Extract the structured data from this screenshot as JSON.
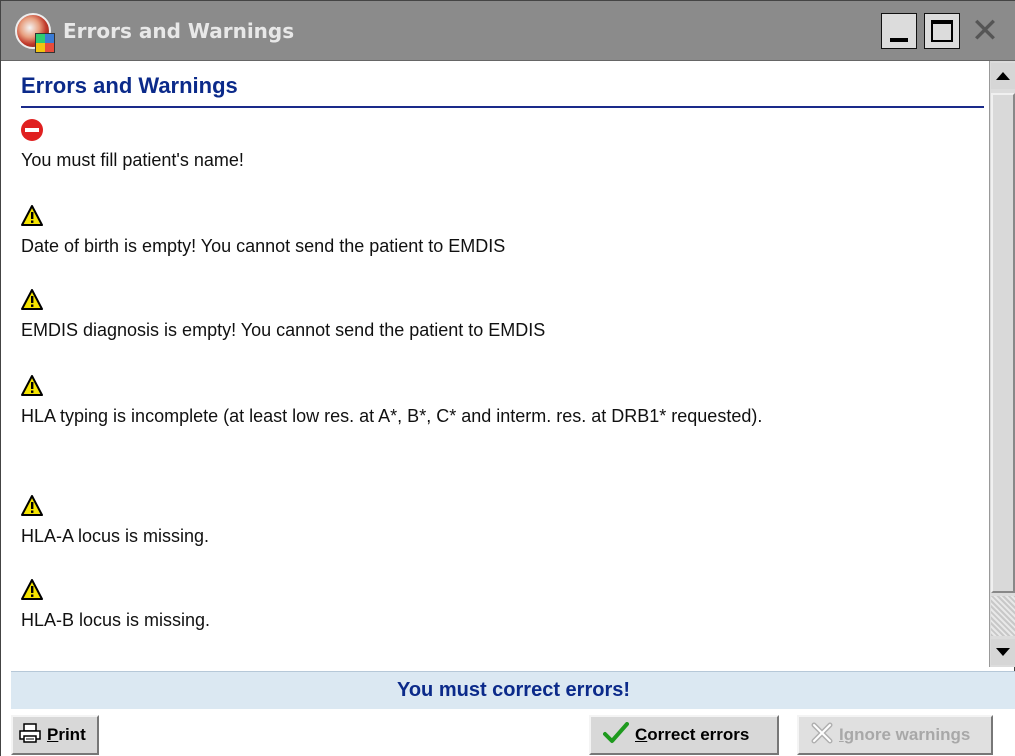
{
  "window": {
    "title": "Errors and Warnings",
    "controls": {
      "minimize_icon": "minimize-icon",
      "maximize_icon": "maximize-icon",
      "close_icon": "close-icon"
    }
  },
  "content": {
    "heading": "Errors and Warnings",
    "messages": [
      {
        "type": "error",
        "icon": "error-icon",
        "text": "You must fill patient's name!"
      },
      {
        "type": "warning",
        "icon": "warning-icon",
        "text": "Date of birth is empty! You cannot send the patient to EMDIS"
      },
      {
        "type": "warning",
        "icon": "warning-icon",
        "text": "EMDIS diagnosis is empty! You cannot send the patient to EMDIS"
      },
      {
        "type": "warning",
        "icon": "warning-icon",
        "text": "HLA typing is incomplete (at least low res. at A*, B*, C* and interm. res. at DRB1* requested)."
      },
      {
        "type": "warning",
        "icon": "warning-icon",
        "text": "HLA-A locus is missing."
      },
      {
        "type": "warning",
        "icon": "warning-icon",
        "text": "HLA-B locus is missing."
      }
    ]
  },
  "status": {
    "text": "You must correct errors!"
  },
  "buttons": {
    "print": {
      "underlined": "P",
      "rest": "rint",
      "icon": "printer-icon"
    },
    "correct": {
      "underlined": "C",
      "rest": "orrect errors",
      "icon": "checkmark-icon",
      "enabled": true
    },
    "ignore": {
      "underlined": "I",
      "rest": "gnore warnings",
      "icon": "ignore-icon",
      "enabled": false
    }
  },
  "colors": {
    "titlebar": "#8b8b8b",
    "heading": "#0b2a8a",
    "error": "#e02020",
    "warning": "#f5e400",
    "status_bg": "#dbe8f2"
  }
}
